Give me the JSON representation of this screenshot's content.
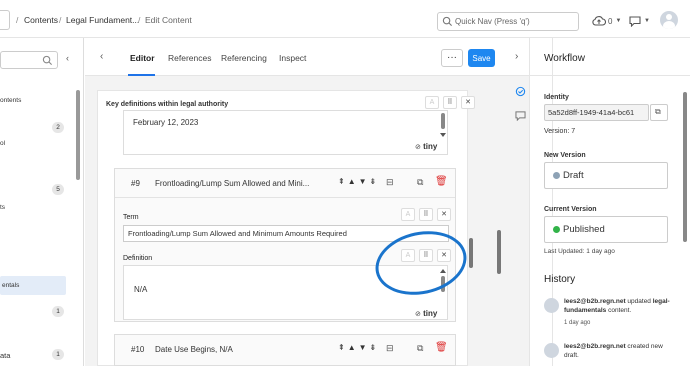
{
  "breadcrumb": {
    "items": [
      "Contents",
      "Legal Fundament...",
      "Edit Content"
    ],
    "separator": "/"
  },
  "header": {
    "quick_nav_placeholder": "Quick Nav (Press 'q')",
    "upload_count": "0"
  },
  "left_panel": {
    "items": [
      {
        "label": "ontents",
        "badge": ""
      },
      {
        "label": "",
        "badge": "2"
      },
      {
        "label": "ol",
        "badge": ""
      },
      {
        "label": "",
        "badge": "5"
      },
      {
        "label": "ts",
        "badge": ""
      },
      {
        "label": "entals",
        "badge": ""
      },
      {
        "label": "",
        "badge": "1"
      },
      {
        "label": "ata",
        "badge": "1"
      }
    ]
  },
  "editor": {
    "tabs": [
      "Editor",
      "References",
      "Referencing",
      "Inspect"
    ],
    "active_tab": "Editor",
    "save_label": "Save",
    "more_label": "···",
    "section_heading": "Key definitions within legal authority",
    "prev_value": "February 12, 2023",
    "tiny_brand": "tiny",
    "items": [
      {
        "number": "#9",
        "title": "Frontloading/Lump Sum Allowed and Mini...",
        "term_label": "Term",
        "term_value": "Frontloading/Lump Sum Allowed and Minimum Amounts Required",
        "definition_label": "Definition",
        "definition_value": "N/A"
      },
      {
        "number": "#10",
        "title": "Date Use Begins, N/A"
      }
    ]
  },
  "workflow": {
    "title": "Workflow",
    "identity_label": "Identity",
    "identity_value": "5a52d8ff-1949-41a4-bc61",
    "version_text": "Version: 7",
    "new_version_label": "New Version",
    "new_version_status": "Draft",
    "current_version_label": "Current Version",
    "current_version_status": "Published",
    "last_updated": "Last Updated: 1 day ago",
    "history_title": "History",
    "history": [
      {
        "user": "lees2@b2b.regn.net",
        "action": "updated",
        "target": "legal-fundamentals",
        "suffix": "content.",
        "time": "1 day ago"
      },
      {
        "user": "lees2@b2b.regn.net",
        "action": "created new",
        "target": "",
        "suffix": "draft.",
        "time": ""
      }
    ]
  },
  "colors": {
    "accent": "#1e87f0",
    "draft": "#8da2b5",
    "published": "#32b349",
    "delete": "#dd3333",
    "annotation": "#1a74cc"
  }
}
